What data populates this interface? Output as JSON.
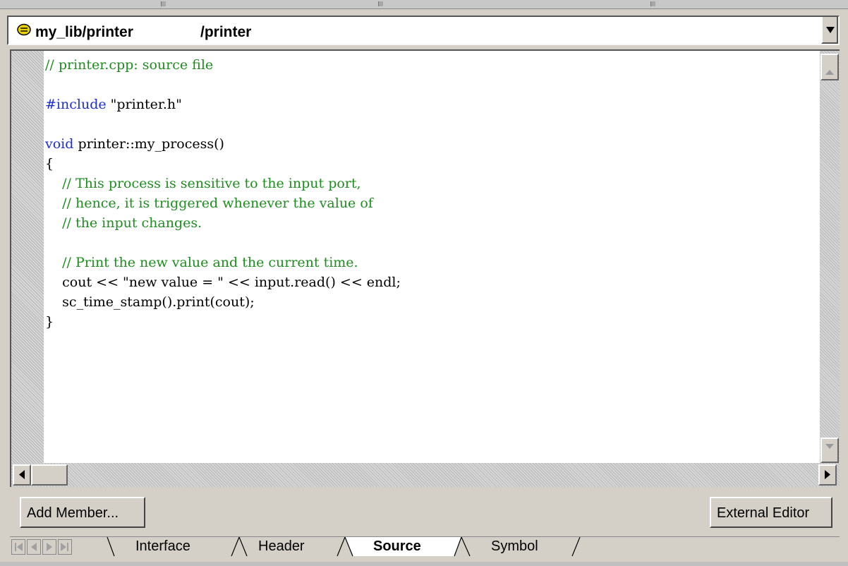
{
  "path_bar": {
    "library": "my_lib/printer",
    "module": "/printer",
    "bullet_icon": "lib-bullet-icon",
    "dropdown_icon": "chevron-down-icon"
  },
  "editor": {
    "lines": [
      "// printer.cpp: source file",
      "",
      "#include \"printer.h\"",
      "",
      "void printer::my_process()",
      "{",
      "    // This process is sensitive to the input port,",
      "    // hence, it is triggered whenever the value of",
      "    // the input changes.",
      "",
      "    // Print the new value and the current time.",
      "    cout << \"new value = \" << input.read() << endl;",
      "    sc_time_stamp().print(cout);",
      "}"
    ],
    "colors": {
      "comment": "#1f8c1f",
      "keyword": "#1f2fcf",
      "text": "#000000"
    }
  },
  "buttons": {
    "add_member": "Add Member...",
    "external_editor": "External Editor"
  },
  "tabs": [
    {
      "label": "Interface",
      "active": false
    },
    {
      "label": "Header",
      "active": false
    },
    {
      "label": "Source",
      "active": true
    },
    {
      "label": "Symbol",
      "active": false
    }
  ]
}
